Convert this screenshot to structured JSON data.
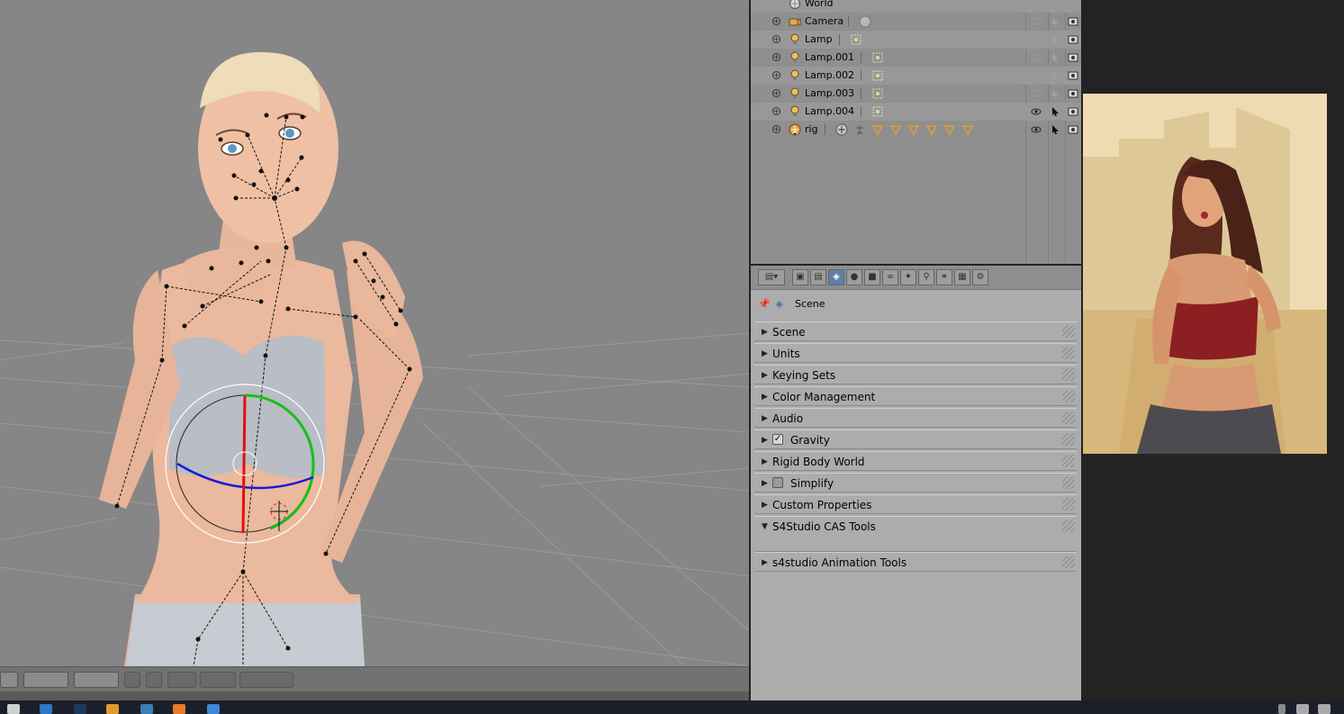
{
  "outliner": {
    "rows": [
      {
        "label": "World",
        "icon": "world-icon"
      },
      {
        "label": "Camera",
        "icon": "camera-icon"
      },
      {
        "label": "Lamp",
        "icon": "lamp-icon"
      },
      {
        "label": "Lamp.001",
        "icon": "lamp-icon"
      },
      {
        "label": "Lamp.002",
        "icon": "lamp-icon"
      },
      {
        "label": "Lamp.003",
        "icon": "lamp-icon"
      },
      {
        "label": "Lamp.004",
        "icon": "lamp-icon"
      },
      {
        "label": "rig",
        "icon": "armature-icon"
      }
    ]
  },
  "properties": {
    "context_path": "Scene",
    "panels": [
      {
        "label": "Scene",
        "expanded": false
      },
      {
        "label": "Units",
        "expanded": false
      },
      {
        "label": "Keying Sets",
        "expanded": false
      },
      {
        "label": "Color Management",
        "expanded": false
      },
      {
        "label": "Audio",
        "expanded": false
      },
      {
        "label": "Gravity",
        "expanded": false,
        "checkbox": true,
        "checked": true
      },
      {
        "label": "Rigid Body World",
        "expanded": false
      },
      {
        "label": "Simplify",
        "expanded": false,
        "checkbox": true,
        "checked": false
      },
      {
        "label": "Custom Properties",
        "expanded": false
      },
      {
        "label": "S4Studio CAS Tools",
        "expanded": true
      },
      {
        "label": "s4studio Animation Tools",
        "expanded": false
      }
    ]
  },
  "colors": {
    "viewport_bg": "#868686",
    "x_axis": "#e01010",
    "y_axis": "#16c016",
    "z_axis": "#1a1ad8",
    "active_context": "#5f7fa8"
  }
}
